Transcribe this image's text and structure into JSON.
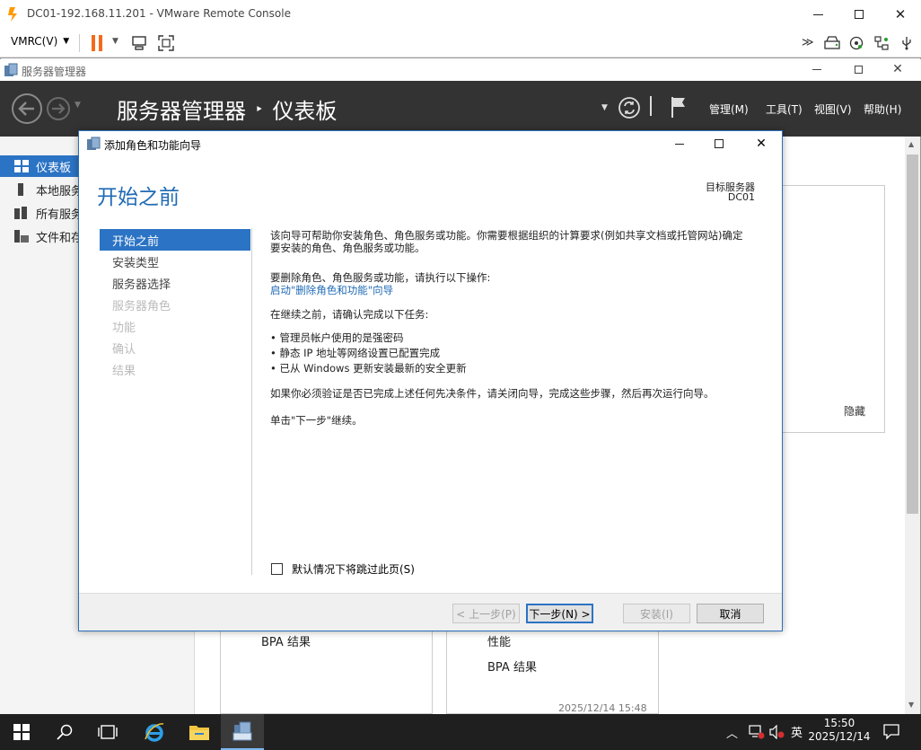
{
  "vmrc": {
    "title": "DC01-192.168.11.201 - VMware Remote Console",
    "menu_label": "VMRC(V)",
    "colors": {
      "accent": "#ff9900"
    }
  },
  "server_manager": {
    "window_title": "服务器管理器",
    "breadcrumb_app": "服务器管理器",
    "breadcrumb_sep": "‣",
    "breadcrumb_page": "仪表板",
    "menu": [
      "管理(M)",
      "工具(T)",
      "视图(V)",
      "帮助(H)"
    ],
    "sidebar": [
      {
        "label": "仪表板",
        "icon": "dashboard-icon"
      },
      {
        "label": "本地服务",
        "icon": "local-server-icon"
      },
      {
        "label": "所有服务",
        "icon": "all-servers-icon"
      },
      {
        "label": "文件和存",
        "icon": "file-storage-icon"
      }
    ],
    "hide_label": "隐藏",
    "tiles": {
      "bpa_left": "BPA 结果",
      "performance": "性能",
      "bpa_right": "BPA 结果",
      "timestamp": "2025/12/14 15:48"
    }
  },
  "wizard": {
    "title": "添加角色和功能向导",
    "heading": "开始之前",
    "target_label": "目标服务器",
    "target_value": "DC01",
    "steps": [
      "开始之前",
      "安装类型",
      "服务器选择",
      "服务器角色",
      "功能",
      "确认",
      "结果"
    ],
    "intro_line1": "该向导可帮助你安装角色、角色服务或功能。你需要根据组织的计算要求(例如共享文档或托管网站)确定",
    "intro_line2": "要安装的角色、角色服务或功能。",
    "remove_label": "要删除角色、角色服务或功能，请执行以下操作:",
    "remove_link": "启动\"删除角色和功能\"向导",
    "confirm_label": "在继续之前，请确认完成以下任务:",
    "tasks": [
      "管理员帐户使用的是强密码",
      "静态 IP 地址等网络设置已配置完成",
      "已从 Windows 更新安装最新的安全更新"
    ],
    "prereq_text": "如果你必须验证是否已完成上述任何先决条件，请关闭向导，完成这些步骤，然后再次运行向导。",
    "continue_text": "单击\"下一步\"继续。",
    "skip_checkbox": "默认情况下将跳过此页(S)",
    "buttons": {
      "prev": "< 上一步(P)",
      "next": "下一步(N) >",
      "install": "安装(I)",
      "cancel": "取消"
    }
  },
  "taskbar": {
    "time": "15:50",
    "date": "2025/12/14",
    "ime": "英"
  }
}
